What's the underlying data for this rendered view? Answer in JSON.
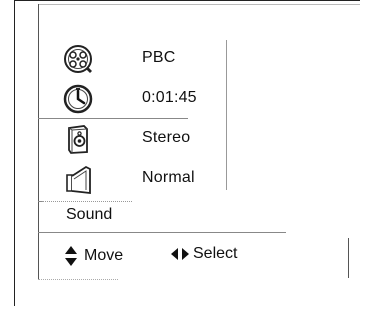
{
  "menu": {
    "items": [
      {
        "icon": "film-reel-icon",
        "label": "PBC"
      },
      {
        "icon": "clock-icon",
        "label": "0:01:45"
      },
      {
        "icon": "speaker-icon",
        "label": "Stereo"
      },
      {
        "icon": "sound-mode-icon",
        "label": "Normal"
      }
    ],
    "title": "Sound"
  },
  "hints": {
    "move": {
      "icon": "up-down-arrows-icon",
      "label": "Move"
    },
    "select": {
      "icon": "left-right-arrows-icon",
      "label": "Select"
    }
  }
}
